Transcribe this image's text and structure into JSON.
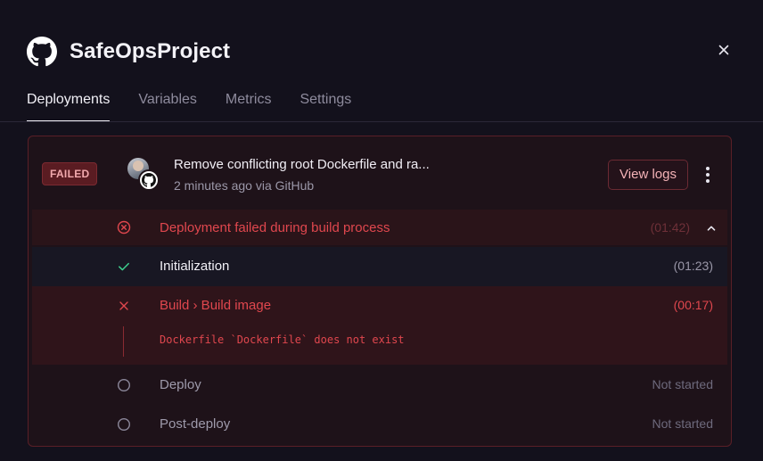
{
  "header": {
    "title": "SafeOpsProject",
    "logo_icon": "github-icon",
    "close_icon": "close-icon"
  },
  "tabs": [
    {
      "label": "Deployments",
      "active": true
    },
    {
      "label": "Variables",
      "active": false
    },
    {
      "label": "Metrics",
      "active": false
    },
    {
      "label": "Settings",
      "active": false
    }
  ],
  "deployment": {
    "status_badge": "FAILED",
    "commit_message": "Remove conflicting root Dockerfile and ra...",
    "meta": "2 minutes ago via GitHub",
    "view_logs_label": "View logs",
    "more_icon": "more-vertical-icon"
  },
  "summary": {
    "label": "Deployment failed during build process",
    "time": "(01:42)",
    "icon": "x-circle-icon"
  },
  "steps": {
    "initialization": {
      "label": "Initialization",
      "time": "(01:23)",
      "icon": "check-icon"
    },
    "build": {
      "label": "Build › Build image",
      "time": "(00:17)",
      "icon": "x-icon",
      "error": "Dockerfile `Dockerfile` does not exist"
    },
    "deploy": {
      "label": "Deploy",
      "time": "Not started",
      "icon": "circle-icon"
    },
    "post_deploy": {
      "label": "Post-deploy",
      "time": "Not started",
      "icon": "circle-icon"
    }
  },
  "colors": {
    "background": "#13111c",
    "error": "#e0474e",
    "success": "#3ecf8e",
    "card_border": "#5a1f27"
  }
}
